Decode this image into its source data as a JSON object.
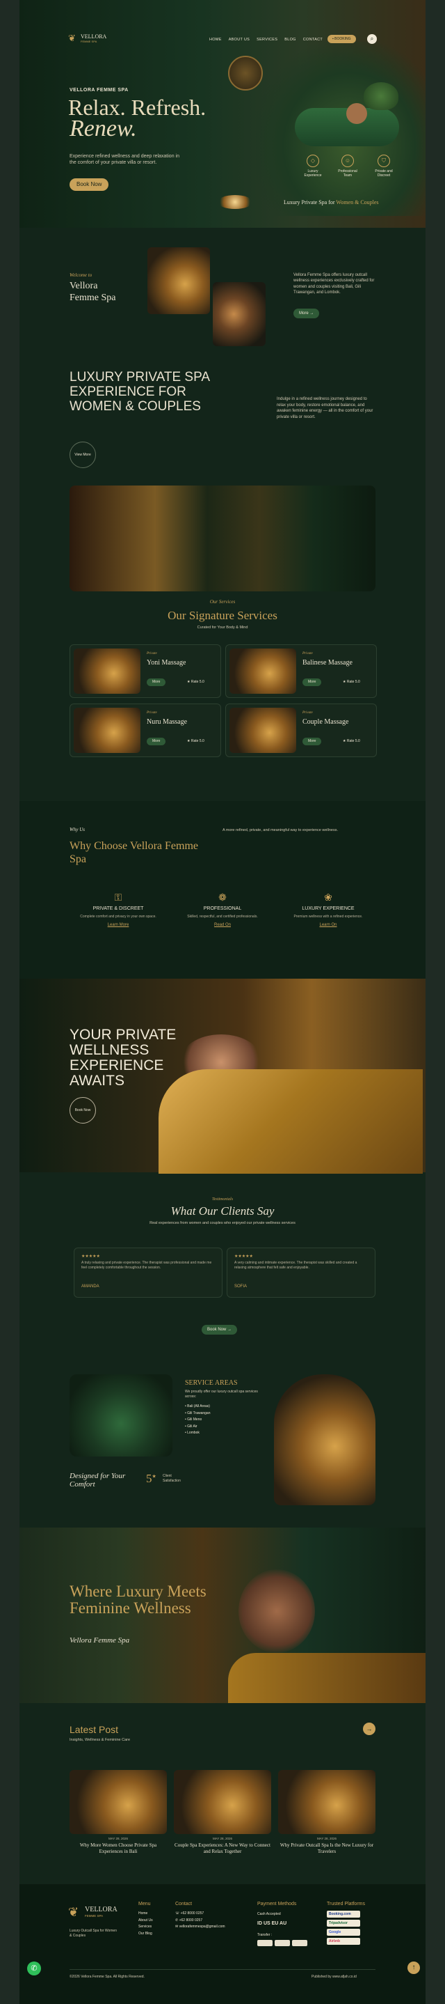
{
  "nav": {
    "brand": "VELLORA",
    "brand_sub": "FEMME SPA",
    "items": [
      "HOME",
      "ABOUT US",
      "SERVICES",
      "BLOG",
      "CONTACT"
    ],
    "booking": "BOOKING"
  },
  "hero": {
    "eyebrow": "VELLORA FEMME SPA",
    "title_line1": "Relax. Refresh.",
    "title_line2": "Renew.",
    "desc": "Experience refined wellness and deep relaxation in the comfort of your private villa or resort.",
    "cta": "Book Now",
    "features": [
      "Luxury Experience",
      "Professional Team",
      "Private and Discreet"
    ],
    "tagline": "Luxury Private Spa for",
    "tagline_accent": "Women & Couples"
  },
  "about": {
    "welcome": "Welcome to",
    "title": "Vellora Femme Spa",
    "desc": "Vellora Femme Spa offers luxury outcall wellness experiences exclusively crafted for women and couples visiting Bali, Gili Trawangan, and Lombok.",
    "more": "More",
    "heading": "LUXURY PRIVATE SPA EXPERIENCE FOR WOMEN & COUPLES",
    "desc2": "Indulge in a refined wellness journey designed to relax your body, restore emotional balance, and awaken feminine energy — all in the comfort of your private villa or resort.",
    "view_more": "View More"
  },
  "services": {
    "eyebrow": "Our Services",
    "title": "Our Signature Services",
    "subtitle": "Curated for Your Body & Mind",
    "items": [
      {
        "tag": "Private",
        "name": "Yoni Massage",
        "more": "More",
        "rate": "Rate 5.0"
      },
      {
        "tag": "Private",
        "name": "Balinese Massage",
        "more": "More",
        "rate": "Rate 5.0"
      },
      {
        "tag": "Private",
        "name": "Nuru Massage",
        "more": "More",
        "rate": "Rate 5.0"
      },
      {
        "tag": "Private",
        "name": "Couple Massage",
        "more": "More",
        "rate": "Rate 5.0"
      }
    ]
  },
  "why": {
    "eyebrow": "Why Us",
    "title": "Why Choose Vellora Femme Spa",
    "desc": "A more refined, private, and meaningful way to experience wellness.",
    "items": [
      {
        "title": "PRIVATE & DISCREET",
        "desc": "Complete comfort and privacy in your own space.",
        "link": "Learn More"
      },
      {
        "title": "PROFESSIONAL",
        "desc": "Skilled, respectful, and certified professionals.",
        "link": "Read On"
      },
      {
        "title": "LUXURY EXPERIENCE",
        "desc": "Premium wellness with a refined experience.",
        "link": "Learn On"
      }
    ]
  },
  "banner": {
    "title": "YOUR PRIVATE WELLNESS EXPERIENCE AWAITS",
    "cta": "Book Now"
  },
  "testimonials": {
    "eyebrow": "Testimonials",
    "title": "What Our Clients Say",
    "subtitle": "Real experiences from women and couples who enjoyed our private wellness services",
    "items": [
      {
        "stars": "★★★★★",
        "text": "A truly relaxing and private experience. The therapist was professional and made me feel completely comfortable throughout the session.",
        "name": "AMANDA"
      },
      {
        "stars": "★★★★★",
        "text": "A very calming and intimate experience. The therapist was skilled and created a relaxing atmosphere that felt safe and enjoyable.",
        "name": "SOFIA"
      }
    ],
    "cta": "Book Now"
  },
  "areas": {
    "title": "SERVICE AREAS",
    "desc": "We proudly offer our luxury outcall spa services across:",
    "list": [
      "Bali (All Areas)",
      "Gili Trawangan",
      "Gili Meno",
      "Gili Air",
      "Lombok"
    ],
    "script": "Designed for Your Comfort",
    "stat_num": "5",
    "stat_sup": "★",
    "stat_label": "Client Satisfaction"
  },
  "luxury": {
    "title": "Where Luxury Meets Feminine Wellness",
    "script": "Vellora Femme Spa"
  },
  "blog": {
    "title": "Latest Post",
    "subtitle": "Insights, Wellness & Feminine Care",
    "posts": [
      {
        "date": "MAY 28, 2026",
        "title": "Why More Women Choose Private Spa Experiences in Bali"
      },
      {
        "date": "MAY 28, 2026",
        "title": "Couple Spa Experiences: A New Way to Connect and Relax Together"
      },
      {
        "date": "MAY 28, 2026",
        "title": "Why Private Outcall Spa Is the New Luxury for Travelers"
      }
    ]
  },
  "footer": {
    "brand": "VELLORA",
    "brand_sub": "FEMME SPA",
    "tagline": "Luxury Outcall Spa for Women & Couples",
    "menu_title": "Menu",
    "menu": [
      "Home",
      "About Us",
      "Services",
      "Our Blog"
    ],
    "contact_title": "Contact",
    "contact": [
      "+62 8000 0257",
      "+62 8000 0257",
      "vellorafemmespa@gmail.com"
    ],
    "payment_title": "Payment Methods",
    "cash": "Cash Accepted",
    "currencies": "ID US EU AU",
    "transfer": "Transfer :",
    "platforms_title": "Trusted Platforms",
    "platforms": [
      "Booking.com",
      "Tripadvisor",
      "Google",
      "Airbnb"
    ],
    "copyright": "©2026 Vellora Femme Spa. All Rights Reserved.",
    "published": "Published by www.afjah.co.id"
  },
  "colors": {
    "gold": "#c9a25a",
    "deep_green": "#13251a",
    "button_green": "#2f5a37"
  }
}
